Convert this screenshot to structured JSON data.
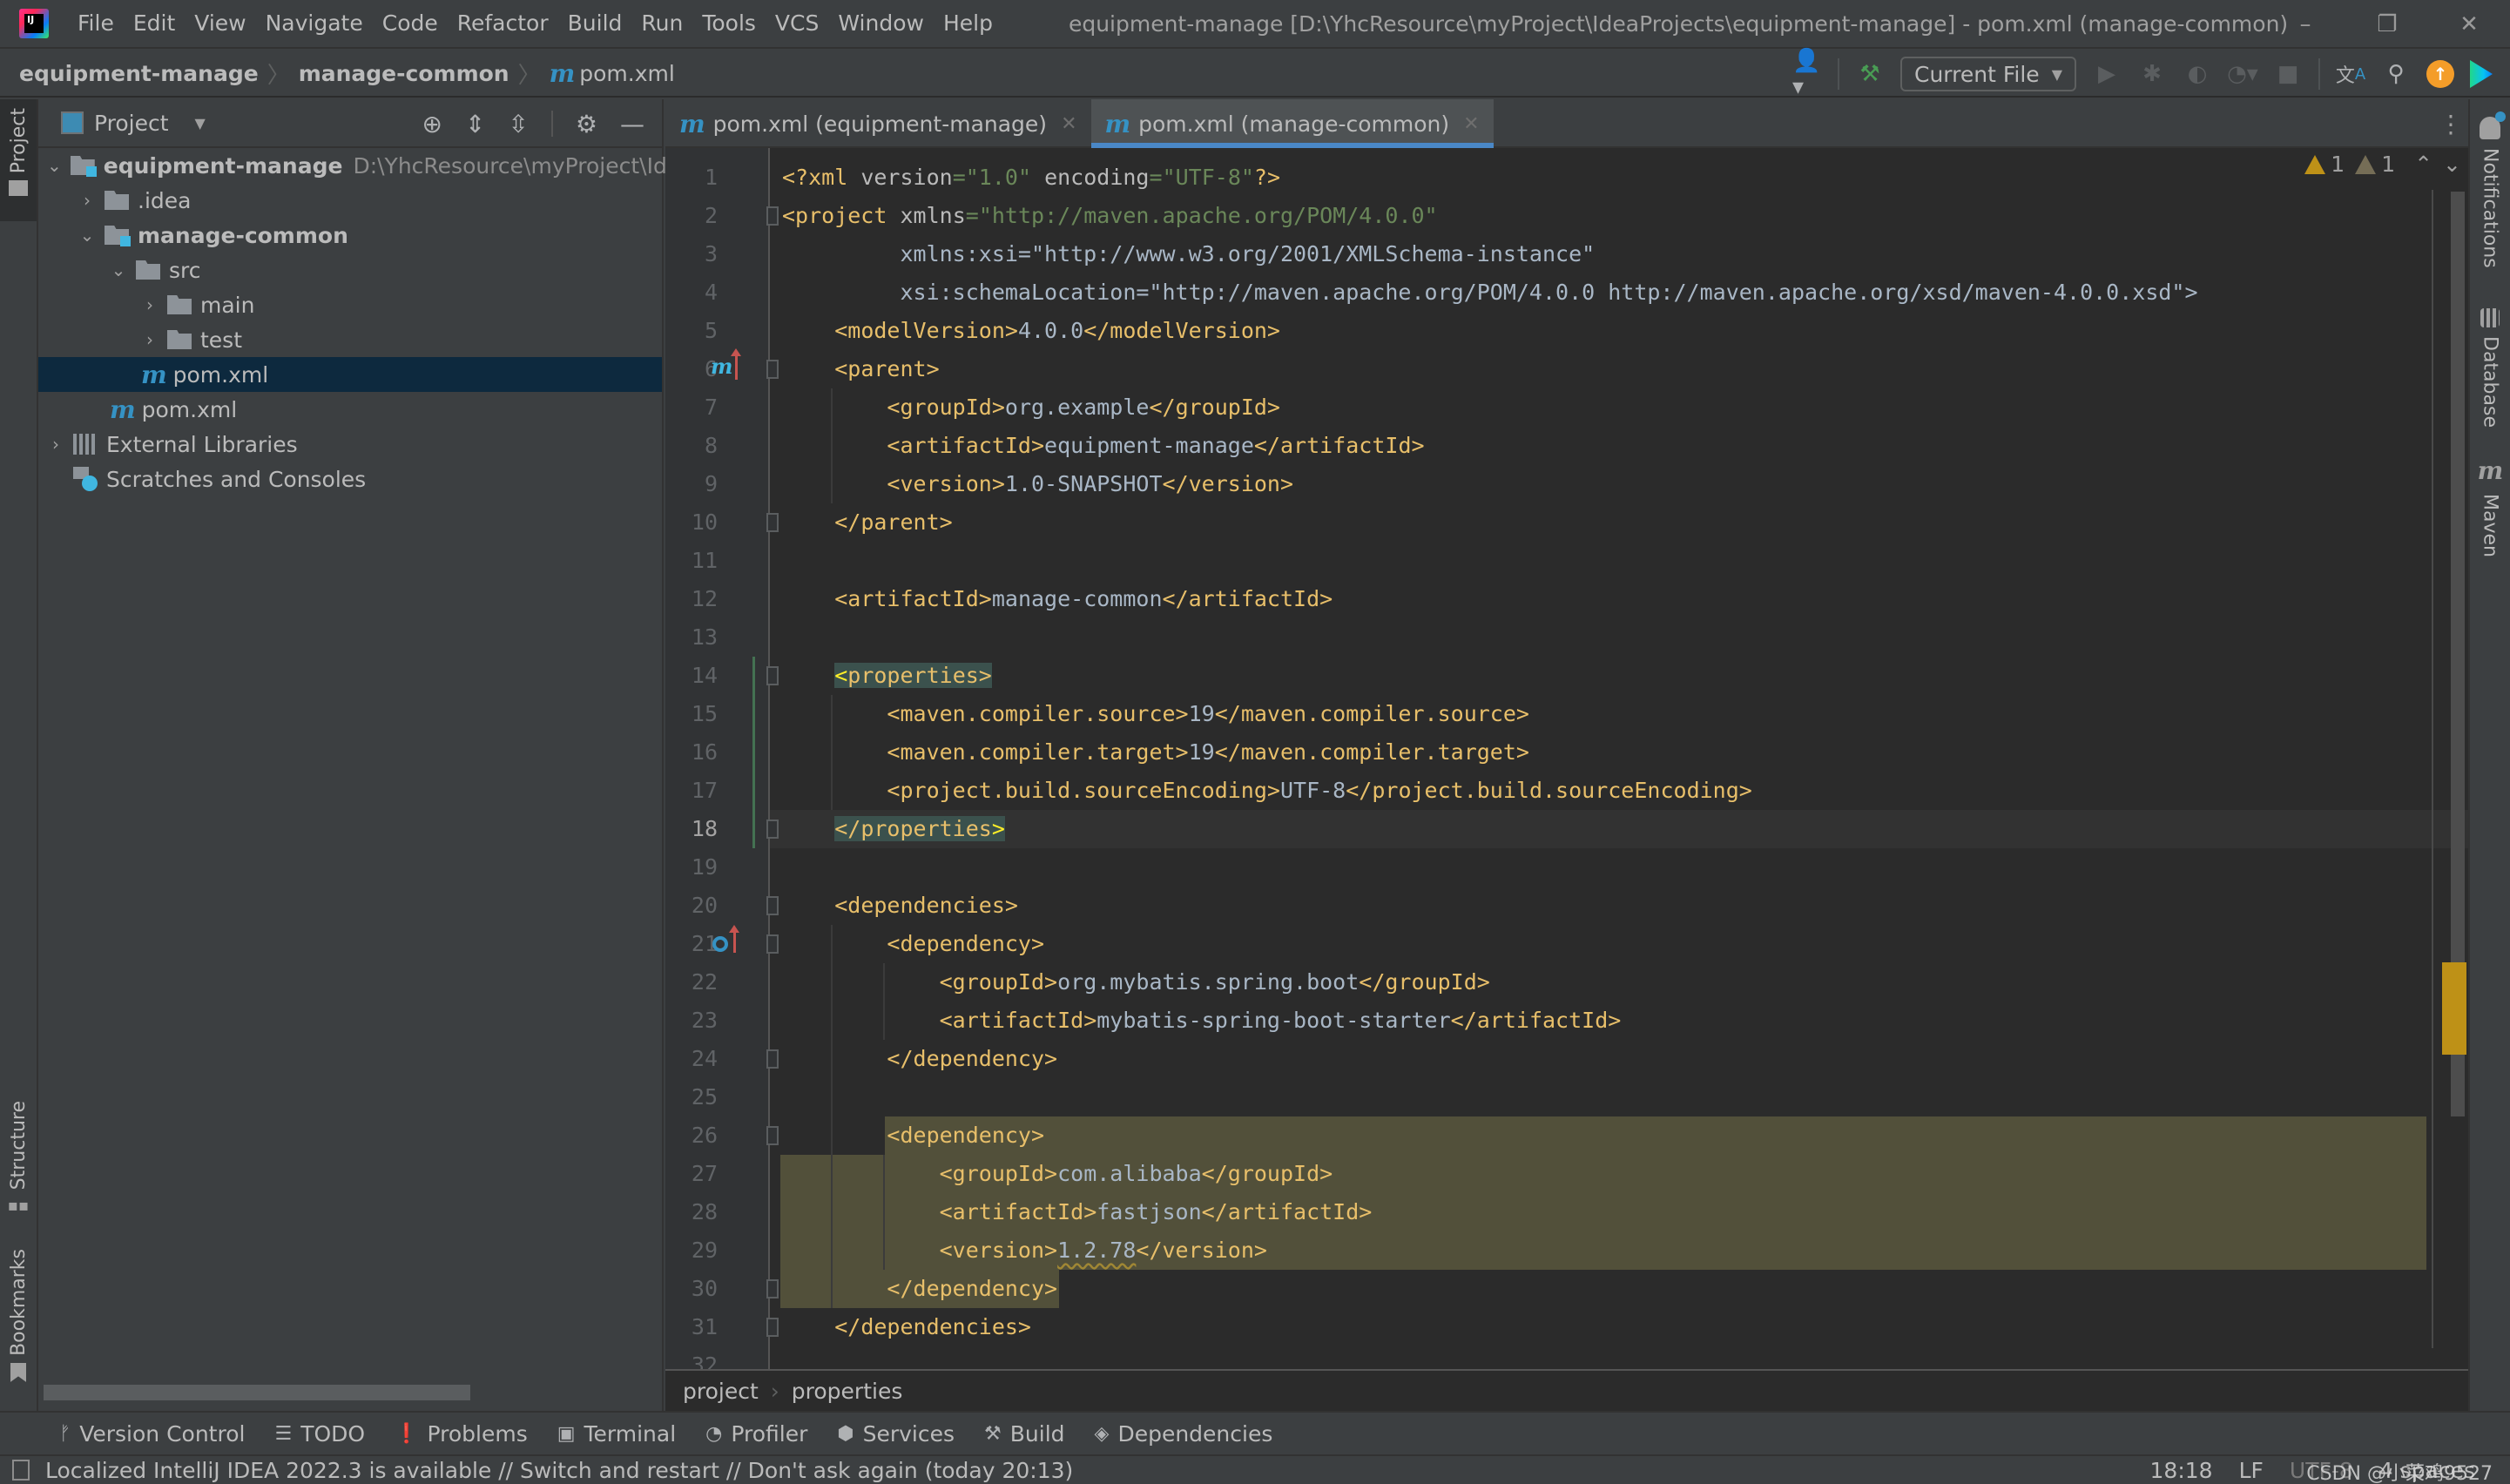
{
  "titlebar": {
    "menu": [
      "File",
      "Edit",
      "View",
      "Navigate",
      "Code",
      "Refactor",
      "Build",
      "Run",
      "Tools",
      "VCS",
      "Window",
      "Help"
    ],
    "window_title": "equipment-manage [D:\\YhcResource\\myProject\\IdeaProjects\\equipment-manage] - pom.xml (manage-common)",
    "controls": {
      "minimize": "–",
      "restore": "❐",
      "close": "✕"
    }
  },
  "navbar": {
    "breadcrumbs": [
      "equipment-manage",
      "manage-common",
      "pom.xml"
    ],
    "run_config": "Current File",
    "icons": [
      "user-icon",
      "build-hammer-icon",
      "run-icon",
      "debug-icon",
      "coverage-icon",
      "profiler-icon",
      "stop-icon",
      "translate-icon",
      "search-icon",
      "update-icon",
      "plugin-icon"
    ]
  },
  "left_stripe": {
    "project": "Project",
    "structure": "Structure",
    "bookmarks": "Bookmarks"
  },
  "project_panel": {
    "title": "Project",
    "tree": [
      {
        "label": "equipment-manage",
        "path": "D:\\YhcResource\\myProject\\IdeaProjects\\equipment-manage",
        "type": "module",
        "expanded": true,
        "depth": 0
      },
      {
        "label": ".idea",
        "type": "folder",
        "expanded": false,
        "depth": 1
      },
      {
        "label": "manage-common",
        "type": "module",
        "expanded": true,
        "depth": 1
      },
      {
        "label": "src",
        "type": "folder",
        "expanded": true,
        "depth": 2
      },
      {
        "label": "main",
        "type": "folder",
        "expanded": false,
        "depth": 3
      },
      {
        "label": "test",
        "type": "folder",
        "expanded": false,
        "depth": 3
      },
      {
        "label": "pom.xml",
        "type": "maven",
        "selected": true,
        "depth": 3
      },
      {
        "label": "pom.xml",
        "type": "maven",
        "depth": 2
      },
      {
        "label": "External Libraries",
        "type": "libraries",
        "expanded": false,
        "depth": 0
      },
      {
        "label": "Scratches and Consoles",
        "type": "scratches",
        "depth": 0
      }
    ]
  },
  "tabs": [
    {
      "label": "pom.xml (equipment-manage)",
      "active": false
    },
    {
      "label": "pom.xml (manage-common)",
      "active": true
    }
  ],
  "editor": {
    "current_line": 18,
    "inspections": {
      "warnings": "1",
      "weak_warnings": "1"
    },
    "lines": [
      "<?xml version=\"1.0\" encoding=\"UTF-8\"?>",
      "<project xmlns=\"http://maven.apache.org/POM/4.0.0\"",
      "         xmlns:xsi=\"http://www.w3.org/2001/XMLSchema-instance\"",
      "         xsi:schemaLocation=\"http://maven.apache.org/POM/4.0.0 http://maven.apache.org/xsd/maven-4.0.0.xsd\">",
      "    <modelVersion>4.0.0</modelVersion>",
      "    <parent>",
      "        <groupId>org.example</groupId>",
      "        <artifactId>equipment-manage</artifactId>",
      "        <version>1.0-SNAPSHOT</version>",
      "    </parent>",
      "",
      "    <artifactId>manage-common</artifactId>",
      "",
      "    <properties>",
      "        <maven.compiler.source>19</maven.compiler.source>",
      "        <maven.compiler.target>19</maven.compiler.target>",
      "        <project.build.sourceEncoding>UTF-8</project.build.sourceEncoding>",
      "    </properties>",
      "",
      "    <dependencies>",
      "        <dependency>",
      "            <groupId>org.mybatis.spring.boot</groupId>",
      "            <artifactId>mybatis-spring-boot-starter</artifactId>",
      "        </dependency>",
      "",
      "        <dependency>",
      "            <groupId>com.alibaba</groupId>",
      "            <artifactId>fastjson</artifactId>",
      "            <version>1.2.78</version>",
      "        </dependency>",
      "    </dependencies>",
      ""
    ],
    "code_breadcrumbs": [
      "project",
      "properties"
    ]
  },
  "right_stripe": {
    "notifications": "Notifications",
    "database": "Database",
    "maven": "Maven"
  },
  "toolwindow_bar": [
    {
      "label": "Version Control",
      "icon": "branch-icon"
    },
    {
      "label": "TODO",
      "icon": "list-icon"
    },
    {
      "label": "Problems",
      "icon": "problems-icon"
    },
    {
      "label": "Terminal",
      "icon": "terminal-icon"
    },
    {
      "label": "Profiler",
      "icon": "profiler-icon"
    },
    {
      "label": "Services",
      "icon": "services-icon"
    },
    {
      "label": "Build",
      "icon": "hammer-icon"
    },
    {
      "label": "Dependencies",
      "icon": "layers-icon"
    }
  ],
  "statusbar": {
    "message": "Localized IntelliJ IDEA 2022.3 is available // Switch and restart // Don't ask again (today 20:13)",
    "position": "18:18",
    "line_separator": "LF",
    "encoding": "UTF-8",
    "indent": "4 spaces",
    "watermark": "CSDN @小菜鸡9527"
  }
}
